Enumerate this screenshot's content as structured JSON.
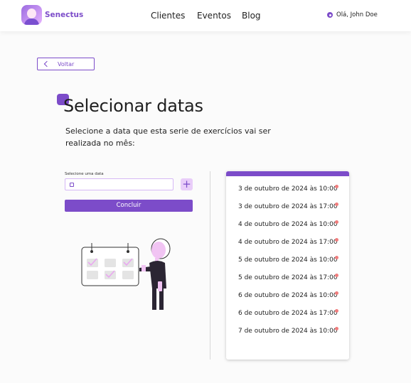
{
  "header": {
    "brand": "Senectus",
    "nav": [
      "Clientes",
      "Eventos",
      "Blog"
    ],
    "user_greeting": "Olá, John Doe"
  },
  "back_button": {
    "label": "Voltar"
  },
  "page": {
    "title": "Selecionar datas",
    "subtitle": "Selecione a data que esta serie de exercícios vai ser realizada no mês:"
  },
  "form": {
    "date_label": "Selecione uma data",
    "date_value": "",
    "add_symbol": "+",
    "submit_label": "Concluir"
  },
  "dates": [
    "3 de outubro de 2024 às 10:00",
    "3 de outubro de 2024 às 17:00",
    "4 de outubro de 2024 às 10:00",
    "4 de outubro de 2024 às 17:00",
    "5 de outubro de 2024 às 10:00",
    "5 de outubro de 2024 às 17:00",
    "6 de outubro de 2024 às 10:00",
    "6 de outubro de 2024 às 17:00",
    "7 de outubro de 2024 às 10:00"
  ],
  "colors": {
    "accent": "#7c4cc9",
    "accent_light": "#e9cdf9",
    "remove": "#f07d7d"
  },
  "icons": {
    "brand": "senectus-logo-icon",
    "user": "user-icon",
    "back": "chevron-left-icon",
    "calendar": "calendar-icon",
    "remove": "remove-dot-icon"
  }
}
